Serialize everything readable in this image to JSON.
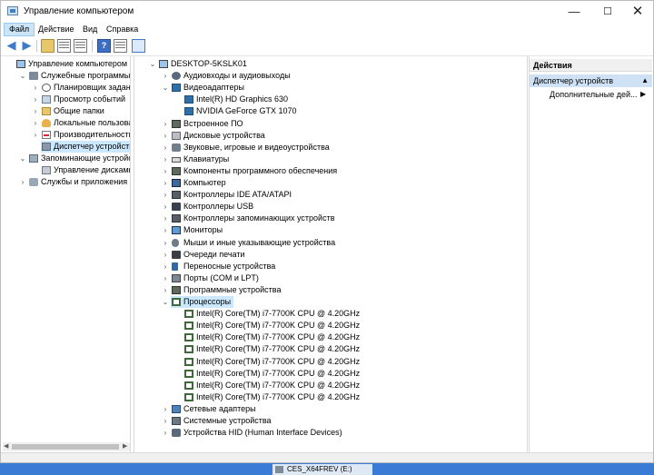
{
  "window": {
    "title": "Управление компьютером"
  },
  "menu": [
    "Файл",
    "Действие",
    "Вид",
    "Справка"
  ],
  "left_tree": [
    {
      "label": "Управление компьютером (л",
      "level": 0,
      "expander": "",
      "icon": "computer-icon",
      "cls": "ico-pc"
    },
    {
      "label": "Служебные программы",
      "level": 1,
      "expander": "v",
      "icon": "tools-icon",
      "cls": "ico-tool"
    },
    {
      "label": "Планировщик заданий",
      "level": 2,
      "expander": ">",
      "icon": "clock-icon",
      "cls": "ico-clock"
    },
    {
      "label": "Просмотр событий",
      "level": 2,
      "expander": ">",
      "icon": "event-log-icon",
      "cls": "ico-log"
    },
    {
      "label": "Общие папки",
      "level": 2,
      "expander": ">",
      "icon": "shared-folder-icon",
      "cls": "ico-folder"
    },
    {
      "label": "Локальные пользовате",
      "level": 2,
      "expander": ">",
      "icon": "users-icon",
      "cls": "ico-users"
    },
    {
      "label": "Производительность",
      "level": 2,
      "expander": ">",
      "icon": "performance-icon",
      "cls": "ico-perf"
    },
    {
      "label": "Диспетчер устройств",
      "level": 2,
      "expander": "",
      "icon": "device-manager-icon",
      "cls": "ico-dm",
      "selected": true
    },
    {
      "label": "Запоминающие устройст",
      "level": 1,
      "expander": "v",
      "icon": "storage-icon",
      "cls": "ico-storage"
    },
    {
      "label": "Управление дисками",
      "level": 2,
      "expander": "",
      "icon": "disk-icon",
      "cls": "ico-disk"
    },
    {
      "label": "Службы и приложения",
      "level": 1,
      "expander": ">",
      "icon": "services-icon",
      "cls": "ico-services"
    }
  ],
  "device_tree": [
    {
      "label": "DESKTOP-5KSLK01",
      "level": 0,
      "expander": "v",
      "icon": "computer-icon",
      "cls": "ico-pc"
    },
    {
      "label": "Аудиовходы и аудиовыходы",
      "level": 1,
      "expander": ">",
      "icon": "audio-icon",
      "cls": "ico-audio"
    },
    {
      "label": "Видеоадаптеры",
      "level": 1,
      "expander": "v",
      "icon": "video-adapter-icon",
      "cls": "ico-video"
    },
    {
      "label": "Intel(R) HD Graphics 630",
      "level": 2,
      "expander": "",
      "icon": "video-adapter-icon",
      "cls": "ico-video"
    },
    {
      "label": "NVIDIA GeForce GTX 1070",
      "level": 2,
      "expander": "",
      "icon": "video-adapter-icon",
      "cls": "ico-video"
    },
    {
      "label": "Встроенное ПО",
      "level": 1,
      "expander": ">",
      "icon": "firmware-icon",
      "cls": "ico-chip"
    },
    {
      "label": "Дисковые устройства",
      "level": 1,
      "expander": ">",
      "icon": "disk-drive-icon",
      "cls": "ico-drive"
    },
    {
      "label": "Звуковые, игровые и видеоустройства",
      "level": 1,
      "expander": ">",
      "icon": "sound-icon",
      "cls": "ico-speaker"
    },
    {
      "label": "Клавиатуры",
      "level": 1,
      "expander": ">",
      "icon": "keyboard-icon",
      "cls": "ico-kbd"
    },
    {
      "label": "Компоненты программного обеспечения",
      "level": 1,
      "expander": ">",
      "icon": "software-component-icon",
      "cls": "ico-chip"
    },
    {
      "label": "Компьютер",
      "level": 1,
      "expander": ">",
      "icon": "computer-icon",
      "cls": "ico-comp"
    },
    {
      "label": "Контроллеры IDE ATA/ATAPI",
      "level": 1,
      "expander": ">",
      "icon": "ide-controller-icon",
      "cls": "ico-ctrl"
    },
    {
      "label": "Контроллеры USB",
      "level": 1,
      "expander": ">",
      "icon": "usb-icon",
      "cls": "ico-usb"
    },
    {
      "label": "Контроллеры запоминающих устройств",
      "level": 1,
      "expander": ">",
      "icon": "storage-controller-icon",
      "cls": "ico-ctrl"
    },
    {
      "label": "Мониторы",
      "level": 1,
      "expander": ">",
      "icon": "monitor-icon",
      "cls": "ico-monitor"
    },
    {
      "label": "Мыши и иные указывающие устройства",
      "level": 1,
      "expander": ">",
      "icon": "mouse-icon",
      "cls": "ico-mouse"
    },
    {
      "label": "Очереди печати",
      "level": 1,
      "expander": ">",
      "icon": "printer-icon",
      "cls": "ico-printer"
    },
    {
      "label": "Переносные устройства",
      "level": 1,
      "expander": ">",
      "icon": "portable-device-icon",
      "cls": "ico-portable"
    },
    {
      "label": "Порты (COM и LPT)",
      "level": 1,
      "expander": ">",
      "icon": "port-icon",
      "cls": "ico-port"
    },
    {
      "label": "Программные устройства",
      "level": 1,
      "expander": ">",
      "icon": "software-device-icon",
      "cls": "ico-chip"
    },
    {
      "label": "Процессоры",
      "level": 1,
      "expander": "v",
      "icon": "cpu-icon",
      "cls": "ico-cpu",
      "selected": true
    },
    {
      "label": "Intel(R) Core(TM) i7-7700K CPU @ 4.20GHz",
      "level": 2,
      "expander": "",
      "icon": "cpu-icon",
      "cls": "ico-cpu"
    },
    {
      "label": "Intel(R) Core(TM) i7-7700K CPU @ 4.20GHz",
      "level": 2,
      "expander": "",
      "icon": "cpu-icon",
      "cls": "ico-cpu"
    },
    {
      "label": "Intel(R) Core(TM) i7-7700K CPU @ 4.20GHz",
      "level": 2,
      "expander": "",
      "icon": "cpu-icon",
      "cls": "ico-cpu"
    },
    {
      "label": "Intel(R) Core(TM) i7-7700K CPU @ 4.20GHz",
      "level": 2,
      "expander": "",
      "icon": "cpu-icon",
      "cls": "ico-cpu"
    },
    {
      "label": "Intel(R) Core(TM) i7-7700K CPU @ 4.20GHz",
      "level": 2,
      "expander": "",
      "icon": "cpu-icon",
      "cls": "ico-cpu"
    },
    {
      "label": "Intel(R) Core(TM) i7-7700K CPU @ 4.20GHz",
      "level": 2,
      "expander": "",
      "icon": "cpu-icon",
      "cls": "ico-cpu"
    },
    {
      "label": "Intel(R) Core(TM) i7-7700K CPU @ 4.20GHz",
      "level": 2,
      "expander": "",
      "icon": "cpu-icon",
      "cls": "ico-cpu"
    },
    {
      "label": "Intel(R) Core(TM) i7-7700K CPU @ 4.20GHz",
      "level": 2,
      "expander": "",
      "icon": "cpu-icon",
      "cls": "ico-cpu"
    },
    {
      "label": "Сетевые адаптеры",
      "level": 1,
      "expander": ">",
      "icon": "network-adapter-icon",
      "cls": "ico-net"
    },
    {
      "label": "Системные устройства",
      "level": 1,
      "expander": ">",
      "icon": "system-device-icon",
      "cls": "ico-sys"
    },
    {
      "label": "Устройства HID (Human Interface Devices)",
      "level": 1,
      "expander": ">",
      "icon": "hid-icon",
      "cls": "ico-hid"
    }
  ],
  "actions": {
    "header": "Действия",
    "section": "Диспетчер устройств",
    "more": "Дополнительные дей..."
  },
  "taskbar": {
    "item": "CES_X64FREV (E:)"
  }
}
